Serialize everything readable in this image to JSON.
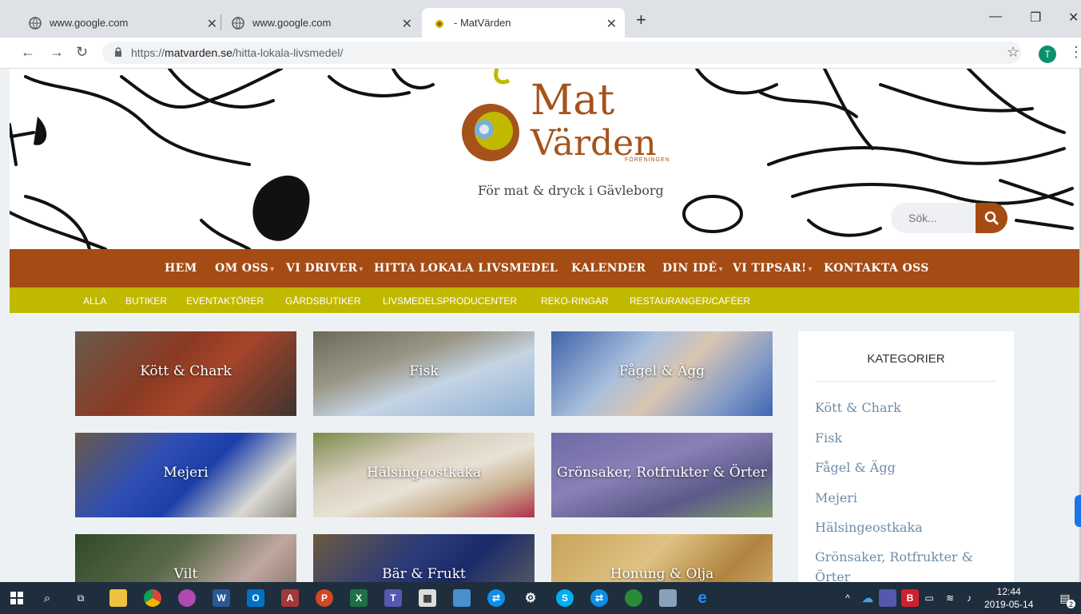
{
  "browser": {
    "tabs": [
      {
        "title": "www.google.com",
        "active": false
      },
      {
        "title": "www.google.com",
        "active": false
      },
      {
        "title": "- MatVärden",
        "active": true
      }
    ],
    "url_prefix": "https://",
    "url_domain": "matvarden.se",
    "url_path": "/hitta-lokala-livsmedel/",
    "profile_initial": "T"
  },
  "header": {
    "logo_line1": "Mat",
    "logo_line2": "Värden",
    "logo_small": "FÖRENINGEN",
    "tagline": "För mat & dryck i Gävleborg",
    "search_placeholder": "Sök..."
  },
  "nav": {
    "items": [
      {
        "label": "HEM",
        "dropdown": false
      },
      {
        "label": "OM OSS",
        "dropdown": true
      },
      {
        "label": "VI DRIVER",
        "dropdown": true
      },
      {
        "label": "HITTA LOKALA LIVSMEDEL",
        "dropdown": false
      },
      {
        "label": "KALENDER",
        "dropdown": false
      },
      {
        "label": "DIN IDÉ",
        "dropdown": true
      },
      {
        "label": "VI TIPSAR!",
        "dropdown": true
      },
      {
        "label": "KONTAKTA OSS",
        "dropdown": false
      }
    ],
    "caret": "▾"
  },
  "subnav": {
    "items": [
      "ALLA",
      "BUTIKER",
      "EVENTAKTÖRER",
      "GÅRDSBUTIKER",
      "LIVSMEDELSPRODUCENTER",
      "REKO-RINGAR",
      "RESTAURANGER/CAFÉER"
    ]
  },
  "tiles": [
    {
      "label": "Kött & Chark"
    },
    {
      "label": "Fisk"
    },
    {
      "label": "Fågel & Ägg"
    },
    {
      "label": "Mejeri"
    },
    {
      "label": "Hälsingeostkaka"
    },
    {
      "label": "Grönsaker, Rotfrukter & Örter"
    },
    {
      "label": "Vilt"
    },
    {
      "label": "Bär & Frukt"
    },
    {
      "label": "Honung & Olja"
    }
  ],
  "sidebar": {
    "title": "KATEGORIER",
    "links": [
      "Kött & Chark",
      "Fisk",
      "Fågel & Ägg",
      "Mejeri",
      "Hälsingeostkaka",
      "Grönsaker, Rotfrukter &",
      "Örter"
    ]
  },
  "taskbar": {
    "time": "12:44",
    "date": "2019-05-14",
    "notifications": "2"
  },
  "colors": {
    "nav_bg": "#a54b14",
    "subnav_bg": "#c1b900",
    "link": "#6f8ca7"
  }
}
